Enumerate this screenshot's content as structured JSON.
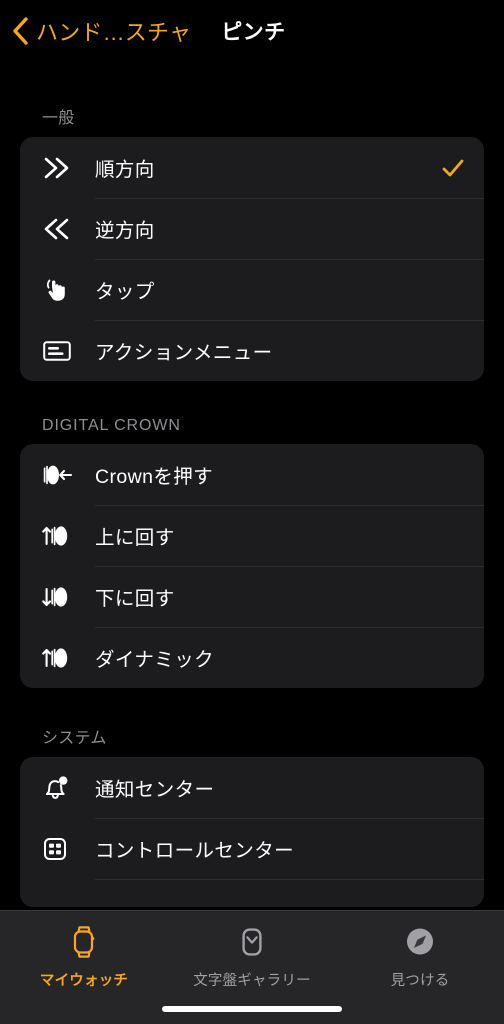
{
  "nav": {
    "back_label": "ハンド…スチャ",
    "back_icon": "chevron-left-icon",
    "title": "ピンチ",
    "accent_color": "#F5A623"
  },
  "colors": {
    "background": "#000000",
    "card": "#1C1C1E",
    "divider": "#2E2E30",
    "primary_text": "#FFFFFF",
    "secondary_text": "#8E8E93",
    "accent": "#F5A623",
    "tabbar": "#262628"
  },
  "sections": [
    {
      "header": "一般",
      "rows": [
        {
          "icon": "chevrons-right-icon",
          "label": "順方向",
          "checked": true
        },
        {
          "icon": "chevrons-left-icon",
          "label": "逆方向",
          "checked": false
        },
        {
          "icon": "hand-tap-icon",
          "label": "タップ",
          "checked": false
        },
        {
          "icon": "action-menu-icon",
          "label": "アクションメニュー",
          "checked": false
        }
      ]
    },
    {
      "header": "DIGITAL CROWN",
      "rows": [
        {
          "icon": "crown-press-icon",
          "label": "Crownを押す",
          "checked": false
        },
        {
          "icon": "crown-rotate-up-icon",
          "label": "上に回す",
          "checked": false
        },
        {
          "icon": "crown-rotate-down-icon",
          "label": "下に回す",
          "checked": false
        },
        {
          "icon": "crown-dynamic-icon",
          "label": "ダイナミック",
          "checked": false
        }
      ]
    },
    {
      "header": "システム",
      "rows": [
        {
          "icon": "bell-icon",
          "label": "通知センター",
          "checked": false
        },
        {
          "icon": "control-center-icon",
          "label": "コントロールセンター",
          "checked": false
        },
        {
          "icon": "partial-row-icon",
          "label": "",
          "checked": false,
          "partial": true
        }
      ]
    }
  ],
  "tabs": [
    {
      "label": "マイウォッチ",
      "icon": "watch-icon",
      "active": true
    },
    {
      "label": "文字盤ギャラリー",
      "icon": "watch-face-icon",
      "active": false
    },
    {
      "label": "見つける",
      "icon": "compass-icon",
      "active": false
    }
  ]
}
